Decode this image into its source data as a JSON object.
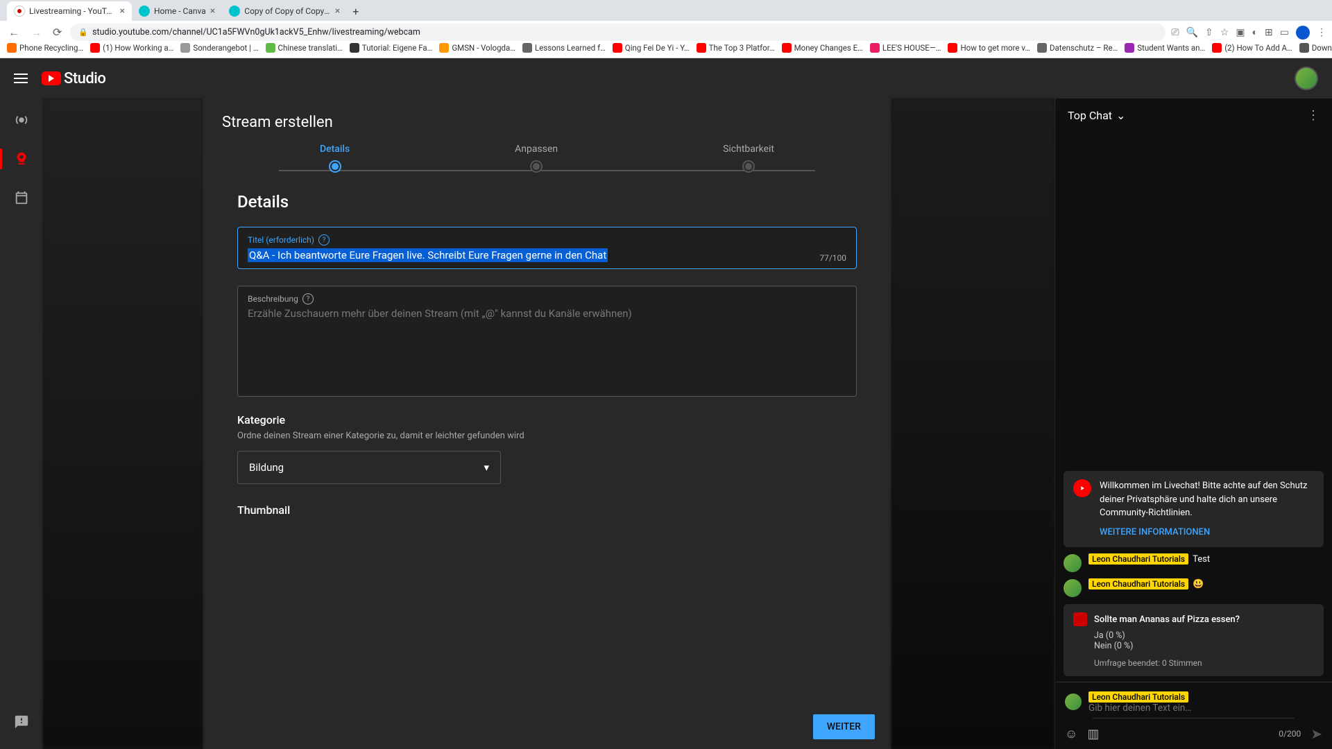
{
  "browser": {
    "tabs": [
      {
        "title": "Livestreaming - YouTube S",
        "active": true
      },
      {
        "title": "Home - Canva"
      },
      {
        "title": "Copy of Copy of Copy of Cop"
      }
    ],
    "url": "studio.youtube.com/channel/UC1a5FWVn0gUk1ackV5_Enhw/livestreaming/webcam",
    "bookmarks": [
      {
        "label": "Phone Recycling…",
        "color": "#ff6d00"
      },
      {
        "label": "(1) How Working a…",
        "color": "#ff0000"
      },
      {
        "label": "Sonderangebot | …",
        "color": "#999"
      },
      {
        "label": "Chinese translati…",
        "color": "#60bb46"
      },
      {
        "label": "Tutorial: Eigene Fa…",
        "color": "#333"
      },
      {
        "label": "GMSN - Vologda…",
        "color": "#ff9800"
      },
      {
        "label": "Lessons Learned f…",
        "color": "#666"
      },
      {
        "label": "Qing Fei De Yi - Y…",
        "color": "#ff0000"
      },
      {
        "label": "The Top 3 Platfor…",
        "color": "#ff0000"
      },
      {
        "label": "Money Changes E…",
        "color": "#ff0000"
      },
      {
        "label": "LEE'S HOUSE—…",
        "color": "#e91e63"
      },
      {
        "label": "How to get more v…",
        "color": "#ff0000"
      },
      {
        "label": "Datenschutz – Re…",
        "color": "#666"
      },
      {
        "label": "Student Wants an…",
        "color": "#9c27b0"
      },
      {
        "label": "(2) How To Add A…",
        "color": "#ff0000"
      },
      {
        "label": "Download - Cooki…",
        "color": "#555"
      }
    ]
  },
  "header": {
    "logo_text": "Studio"
  },
  "modal": {
    "title": "Stream erstellen",
    "steps": [
      "Details",
      "Anpassen",
      "Sichtbarkeit"
    ],
    "section": "Details",
    "title_field": {
      "label": "Titel (erforderlich)",
      "value": "Q&A - Ich beantworte Eure Fragen live. Schreibt Eure Fragen gerne in den Chat",
      "counter": "77/100"
    },
    "desc_field": {
      "label": "Beschreibung",
      "placeholder": "Erzähle Zuschauern mehr über deinen Stream (mit „@\" kannst du Kanäle erwähnen)"
    },
    "category": {
      "title": "Kategorie",
      "desc": "Ordne deinen Stream einer Kategorie zu, damit er leichter gefunden wird",
      "value": "Bildung"
    },
    "thumbnail": {
      "title": "Thumbnail"
    },
    "next": "WEITER"
  },
  "chat": {
    "selector": "Top Chat",
    "welcome": {
      "text": "Willkommen im Livechat! Bitte achte auf den Schutz deiner Privatsphäre und halte dich an unsere Community-Richtlinien.",
      "link": "WEITERE INFORMATIONEN"
    },
    "messages": [
      {
        "author": "Leon Chaudhari Tutorials",
        "text": "Test"
      },
      {
        "author": "Leon Chaudhari Tutorials",
        "text": "😃"
      }
    ],
    "poll": {
      "question": "Sollte man Ananas auf Pizza essen?",
      "opt1": "Ja (0 %)",
      "opt2": "Nein (0 %)",
      "ended": "Umfrage beendet: 0 Stimmen"
    },
    "input": {
      "author": "Leon Chaudhari Tutorials",
      "placeholder": "Gib hier deinen Text ein…",
      "counter": "0/200"
    }
  }
}
